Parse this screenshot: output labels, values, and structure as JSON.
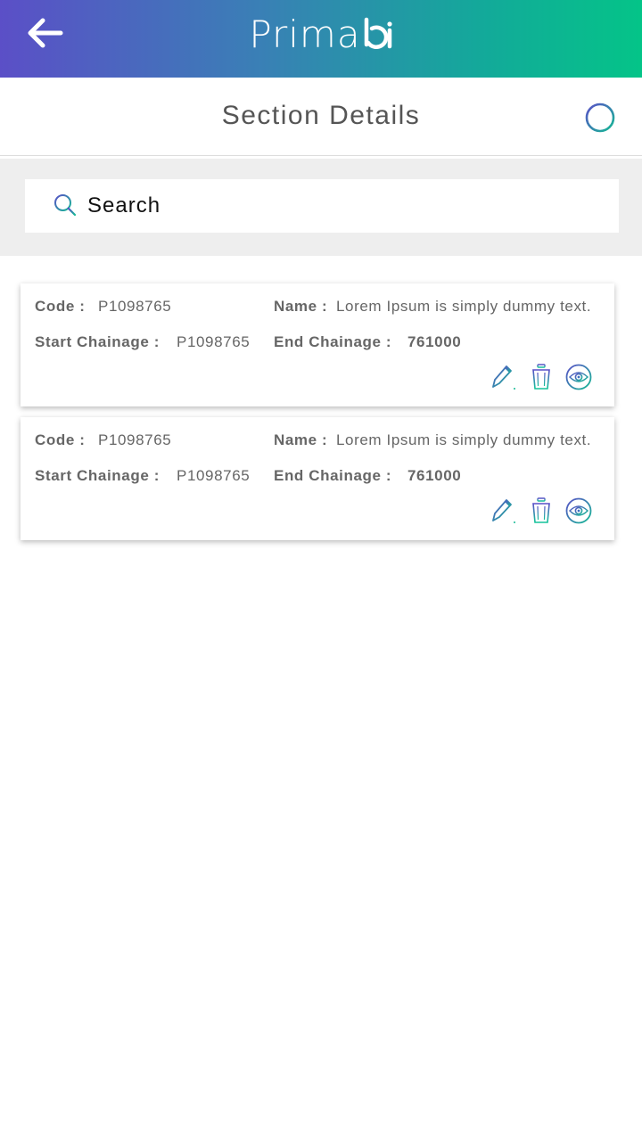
{
  "header": {
    "logo_text": "Prima",
    "logo_mark_text": "bi"
  },
  "page": {
    "title": "Section Details"
  },
  "search": {
    "placeholder": "Search",
    "value": ""
  },
  "labels": {
    "code": "Code :",
    "name": "Name :",
    "start_chainage": "Start Chainage :",
    "end_chainage": "End Chainage :"
  },
  "items": [
    {
      "code": "P1098765",
      "name": "Lorem Ipsum is simply dummy text.",
      "start_chainage": "P1098765",
      "end_chainage": "761000"
    },
    {
      "code": "P1098765",
      "name": "Lorem Ipsum is simply dummy text.",
      "start_chainage": "P1098765",
      "end_chainage": "761000"
    }
  ],
  "icons": {
    "back": "arrow-left-icon",
    "add": "plus-circle-icon",
    "search": "search-icon",
    "edit": "pencil-icon",
    "delete": "trash-icon",
    "view": "eye-icon"
  },
  "colors": {
    "gradient_start": "#5b4fc7",
    "gradient_end": "#04c488",
    "text": "#666666",
    "search_bg": "#eeeeee"
  }
}
